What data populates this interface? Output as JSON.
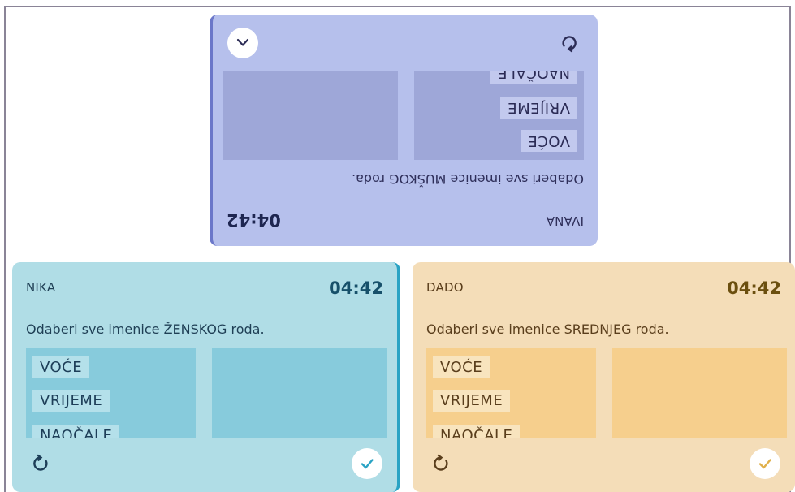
{
  "players": [
    {
      "id": "ivana",
      "name": "IVANA",
      "timer": "04:42",
      "question": "Odaberi sve imenice MUŠKOG roda.",
      "words": [
        "VOĆE",
        "VRIJEME",
        "NAOČALE"
      ],
      "reset_icon": "refresh-icon",
      "action_icon": "chevron-up-icon",
      "colors": {
        "background": "#b6c0ec",
        "pane": "#9ea7d8",
        "accent": "#6b77c9"
      }
    },
    {
      "id": "nika",
      "name": "NIKA",
      "timer": "04:42",
      "question": "Odaberi sve imenice ŽENSKOG roda.",
      "words": [
        "VOĆE",
        "VRIJEME",
        "NAOČALE"
      ],
      "reset_icon": "refresh-icon",
      "action_icon": "check-icon",
      "colors": {
        "background": "#b0dde6",
        "pane": "#87cbdc",
        "accent": "#2aa3c4"
      }
    },
    {
      "id": "dado",
      "name": "DADO",
      "timer": "04:42",
      "question": "Odaberi sve imenice SREDNJEG roda.",
      "words": [
        "VOĆE",
        "VRIJEME",
        "NAOČALE"
      ],
      "reset_icon": "refresh-icon",
      "action_icon": "check-icon",
      "colors": {
        "background": "#f4ddb8",
        "pane": "#f6cf8d",
        "accent": "#e0b04a"
      }
    }
  ]
}
